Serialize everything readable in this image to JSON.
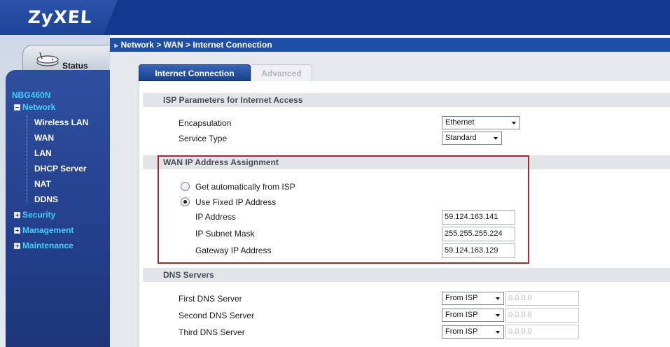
{
  "brand": {
    "logo_text": "ZyXEL"
  },
  "sidebar": {
    "status_label": "Status",
    "device_name": "NBG460N",
    "nav": {
      "network": "Network",
      "network_children": [
        "Wireless LAN",
        "WAN",
        "LAN",
        "DHCP Server",
        "NAT",
        "DDNS"
      ],
      "security": "Security",
      "management": "Management",
      "maintenance": "Maintenance"
    }
  },
  "breadcrumb": "Network > WAN > Internet Connection",
  "tabs": [
    {
      "label": "Internet Connection",
      "active": true
    },
    {
      "label": "Advanced",
      "active": false
    }
  ],
  "isp": {
    "header": "ISP Parameters for Internet Access",
    "encapsulation_label": "Encapsulation",
    "encapsulation_value": "Ethernet",
    "service_type_label": "Service Type",
    "service_type_value": "Standard"
  },
  "wan_ip": {
    "header": "WAN IP Address Assignment",
    "auto_label": "Get automatically from ISP",
    "auto_checked": false,
    "fixed_label": "Use Fixed IP Address",
    "fixed_checked": true,
    "ip_label": "IP Address",
    "ip_value": "59.124.163.141",
    "mask_label": "IP Subnet Mask",
    "mask_value": "255.255.255.224",
    "gateway_label": "Gateway IP Address",
    "gateway_value": "59.124.163.129"
  },
  "dns": {
    "header": "DNS Servers",
    "rows": [
      {
        "label": "First DNS Server",
        "mode": "From ISP",
        "value": "0.0.0.0"
      },
      {
        "label": "Second DNS Server",
        "mode": "From ISP",
        "value": "0.0.0.0"
      },
      {
        "label": "Third DNS Server",
        "mode": "From ISP",
        "value": "0.0.0.0"
      }
    ]
  },
  "colors": {
    "header_blue": "#13398e",
    "nav_cyan": "#3fd1ff",
    "highlight_red": "#a52a2a"
  }
}
